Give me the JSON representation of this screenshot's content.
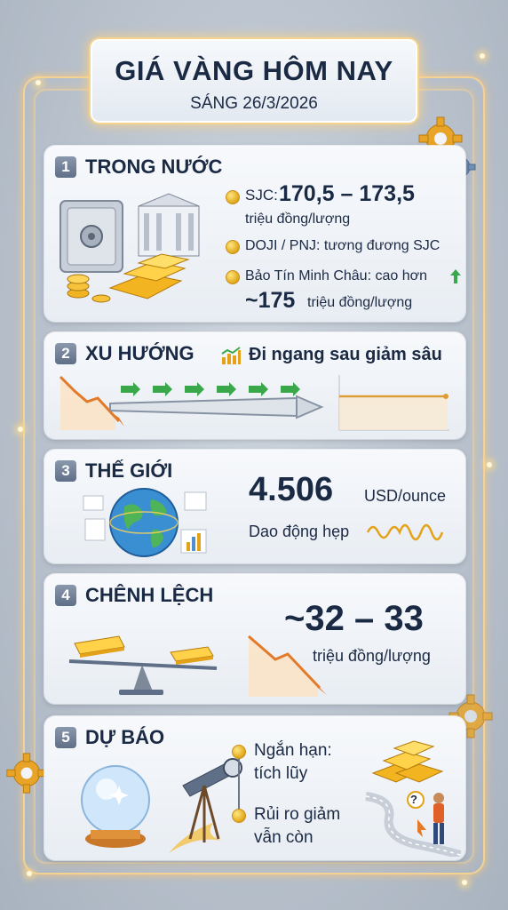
{
  "header": {
    "title": "GIÁ VÀNG HÔM NAY",
    "subtitle": "SÁNG 26/3/2026"
  },
  "sections": {
    "domestic": {
      "number": "1",
      "title": "TRONG NƯỚC",
      "sjc_label": "SJC:",
      "sjc_value": "170,5 – 173,5",
      "sjc_unit": "triệu đồng/lượng",
      "doji_text": "DOJI / PNJ: tương đương SJC",
      "btmc_text": "Bảo Tín Minh Châu: cao hơn",
      "btmc_value": "~175",
      "btmc_unit": "triệu đồng/lượng"
    },
    "trend": {
      "number": "2",
      "title": "XU HƯỚNG",
      "description": "Đi ngang sau giảm sâu"
    },
    "world": {
      "number": "3",
      "title": "THẾ GIỚI",
      "price": "4.506",
      "unit": "USD/ounce",
      "description": "Dao động hẹp"
    },
    "spread": {
      "number": "4",
      "title": "CHÊNH LỆCH",
      "value": "~32 – 33",
      "unit": "triệu đồng/lượng"
    },
    "forecast": {
      "number": "5",
      "title": "DỰ BÁO",
      "short_term": "Ngắn hạn:",
      "short_term_value": "tích lũy",
      "risk_line1": "Rủi ro giảm",
      "risk_line2": "vẫn còn",
      "question_mark": "?"
    }
  },
  "colors": {
    "gold": "#c98a10",
    "navy": "#1b2a44",
    "green_arrow": "#3aa84a",
    "glow": "#ffd68c"
  }
}
